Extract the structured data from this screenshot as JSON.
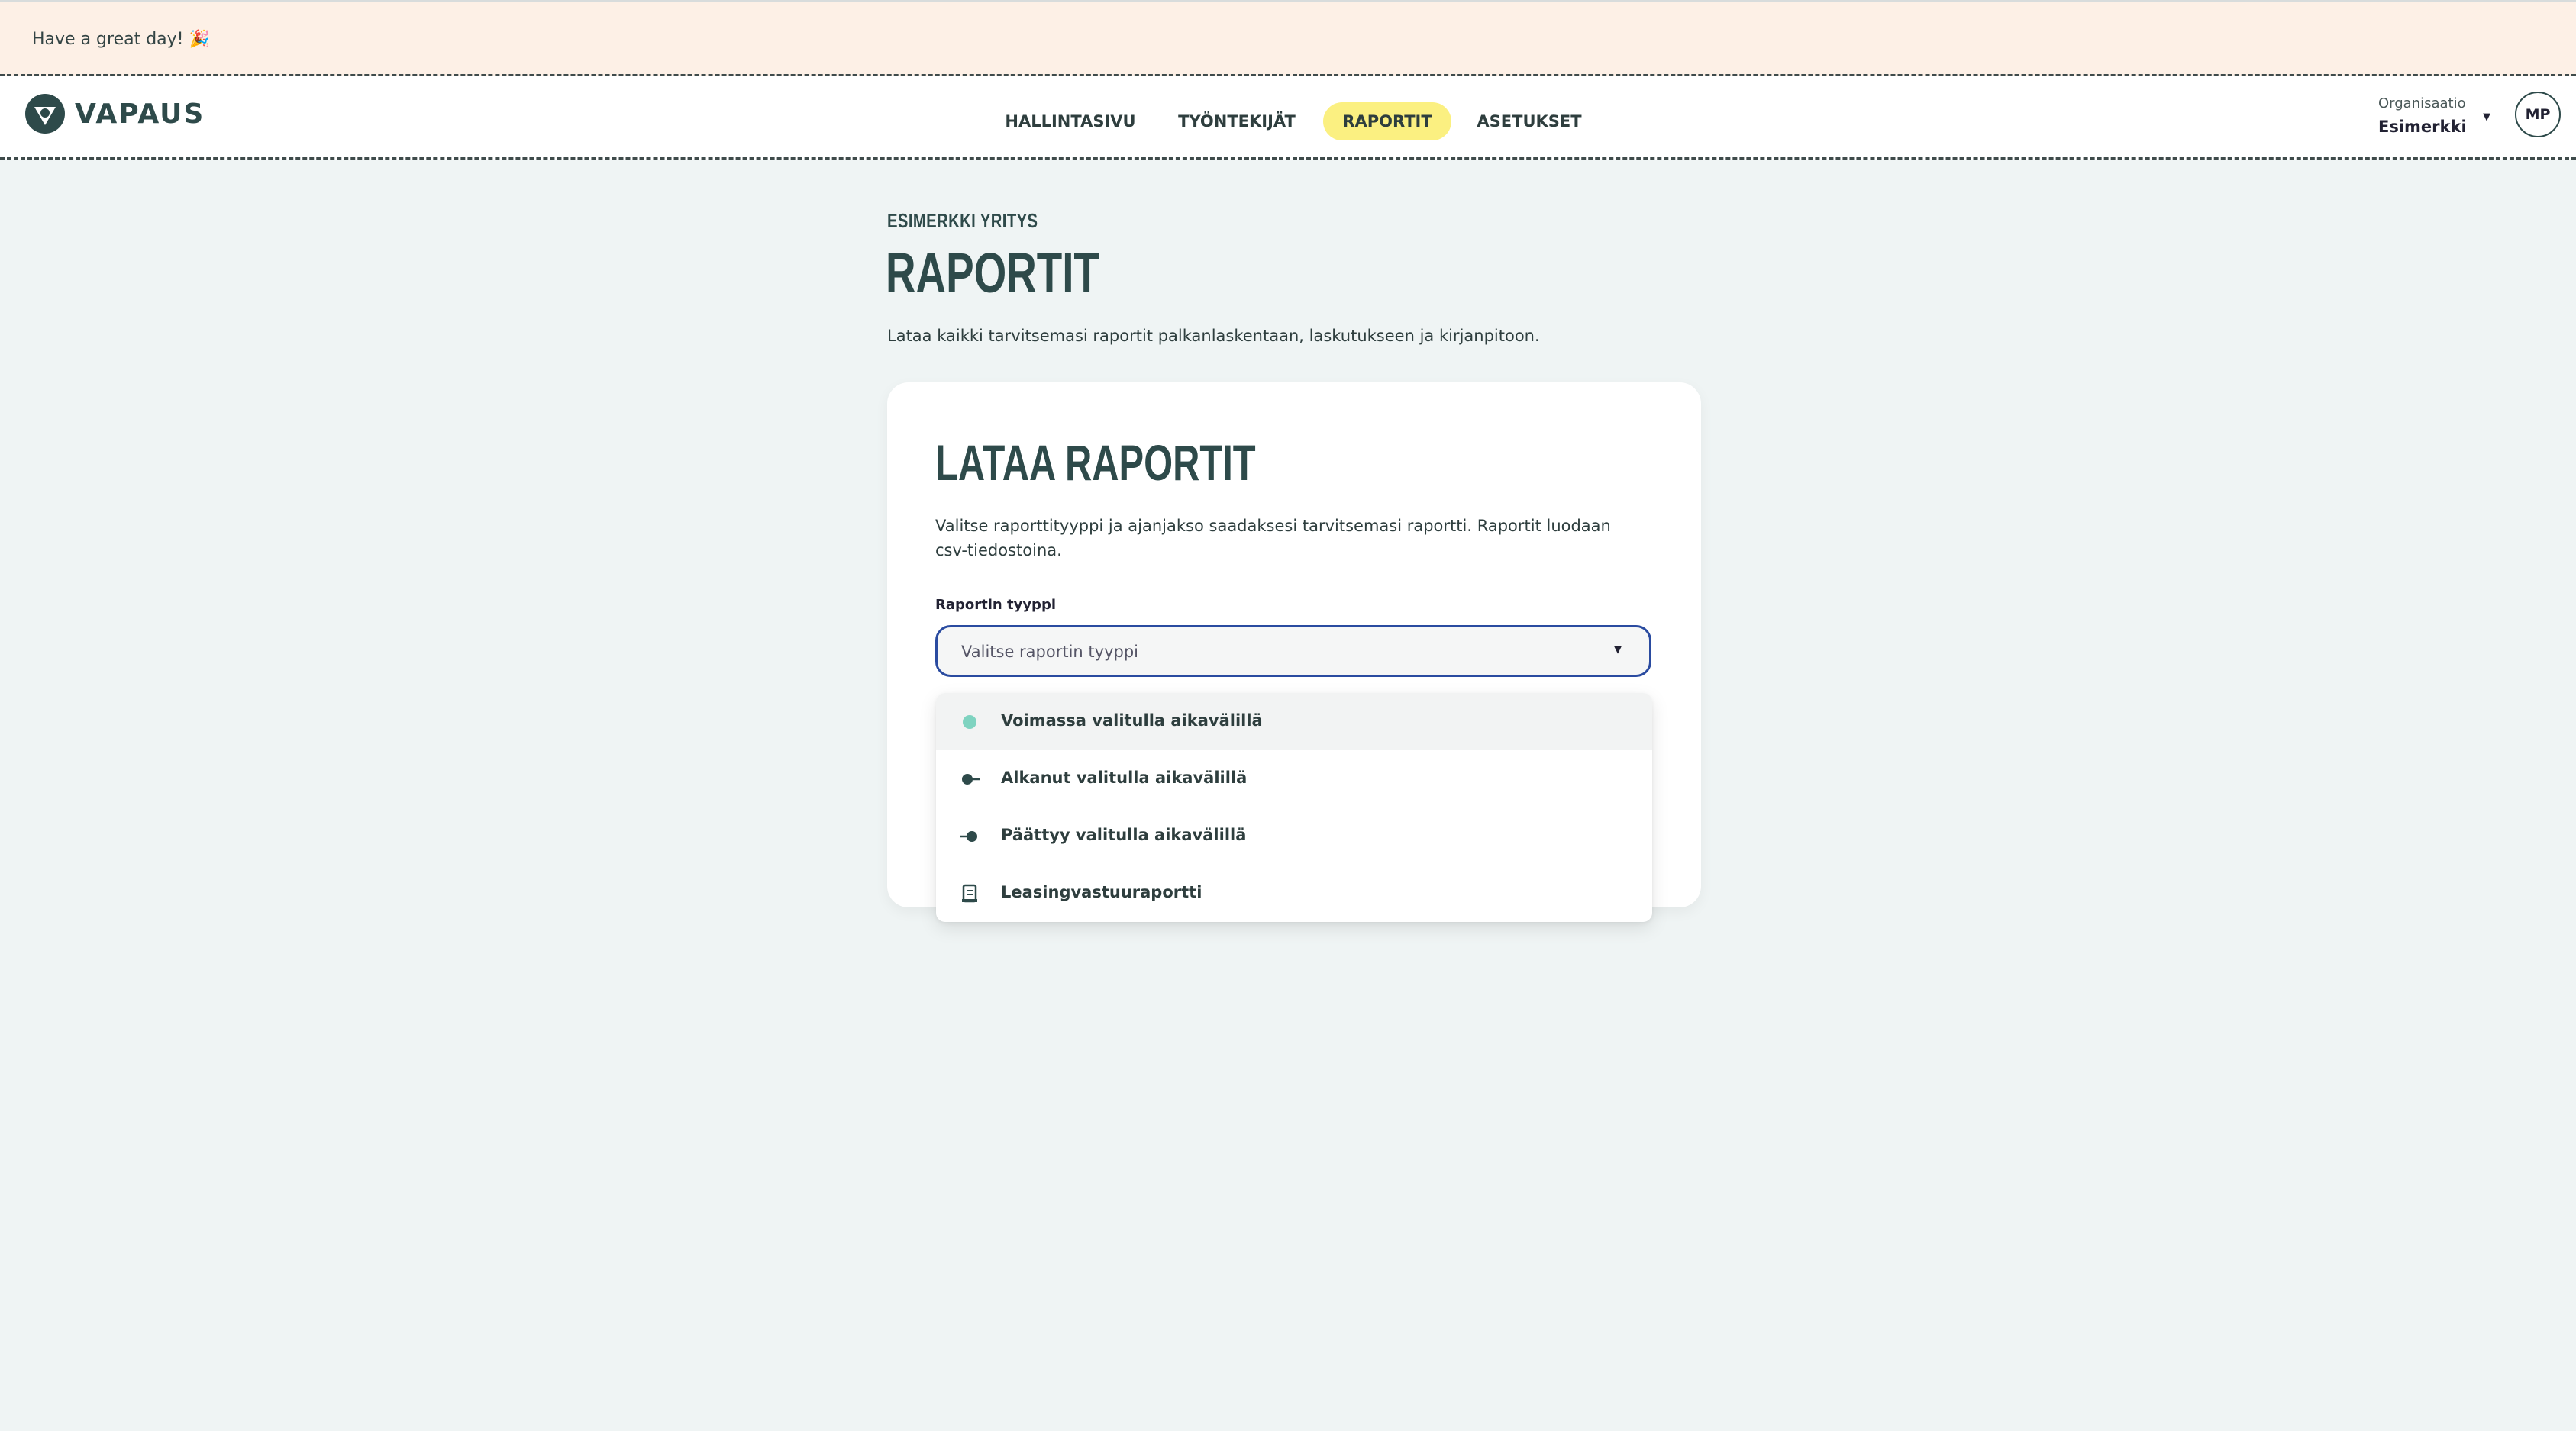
{
  "banner": {
    "text": "Have a great day! 🎉"
  },
  "header": {
    "logo_text": "VAPAUS",
    "nav": [
      {
        "label": "HALLINTASIVU",
        "active": false
      },
      {
        "label": "TYÖNTEKIJÄT",
        "active": false
      },
      {
        "label": "RAPORTIT",
        "active": true
      },
      {
        "label": "ASETUKSET",
        "active": false
      }
    ],
    "org_label": "Organisaatio",
    "org_name": "Esimerkki",
    "avatar_initials": "MP"
  },
  "page": {
    "company": "ESIMERKKI YRITYS",
    "title": "RAPORTIT",
    "description": "Lataa kaikki tarvitsemasi raportit palkanlaskentaan, laskutukseen ja kirjanpitoon."
  },
  "card": {
    "title": "LATAA RAPORTIT",
    "description": "Valitse raporttityyppi ja ajanjakso saadaksesi tarvitsemasi raportti. Raportit luodaan csv-tiedostoina.",
    "field_label": "Raportin tyyppi",
    "select_placeholder": "Valitse raportin tyyppi"
  },
  "dropdown": {
    "options": [
      {
        "label": "Voimassa valitulla aikavälillä",
        "icon": "active-dot-icon"
      },
      {
        "label": "Alkanut valitulla aikavälillä",
        "icon": "start-dot-icon"
      },
      {
        "label": "Päättyy valitulla aikavälillä",
        "icon": "end-dot-icon"
      },
      {
        "label": "Leasingvastuuraportti",
        "icon": "report-document-icon"
      }
    ]
  },
  "colors": {
    "background": "#eff4f4",
    "banner": "#fdf0e6",
    "nav_active": "#fbf081",
    "text_primary": "#2e4a4a",
    "focus_border": "#2a4ba0",
    "active_dot": "#7fd3c0"
  }
}
